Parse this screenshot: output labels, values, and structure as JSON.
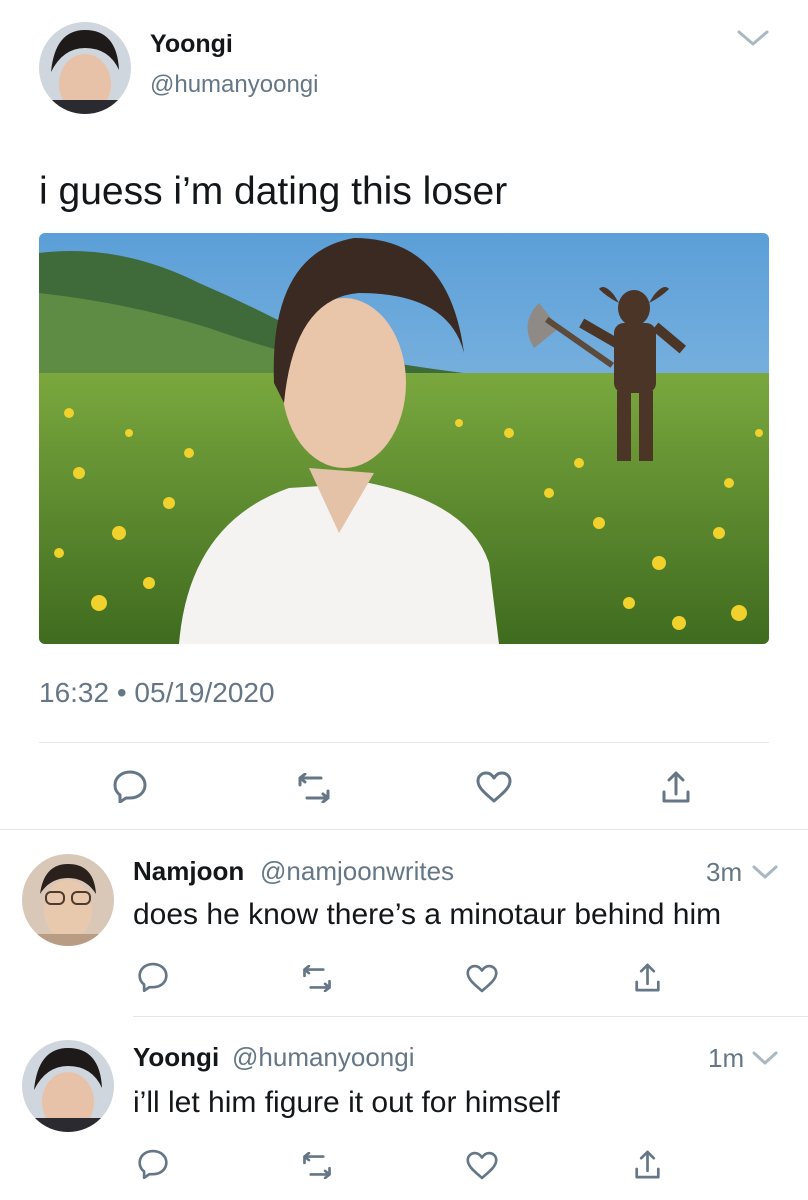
{
  "main_tweet": {
    "display_name": "Yoongi",
    "handle": "@humanyoongi",
    "text": "i guess i’m dating this loser",
    "timestamp": "16:32 • 05/19/2020",
    "image_description": "edited photo: young man in white shirt standing in a flower meadow with a minotaur holding an axe behind him",
    "actions": [
      "reply-icon",
      "retweet-icon",
      "like-icon",
      "share-icon"
    ]
  },
  "replies": [
    {
      "display_name": "Namjoon",
      "handle": "@namjoonwrites",
      "time": "3m",
      "text": "does he know there’s a minotaur behind him",
      "actions": [
        "reply-icon",
        "retweet-icon",
        "like-icon",
        "share-icon"
      ]
    },
    {
      "display_name": "Yoongi",
      "handle": "@humanyoongi",
      "time": "1m",
      "text": "i’ll let him figure it out for himself",
      "actions": [
        "reply-icon",
        "retweet-icon",
        "like-icon",
        "share-icon"
      ]
    }
  ],
  "colors": {
    "text": "#14171a",
    "muted": "#657786",
    "divider": "#e1e8ed"
  }
}
